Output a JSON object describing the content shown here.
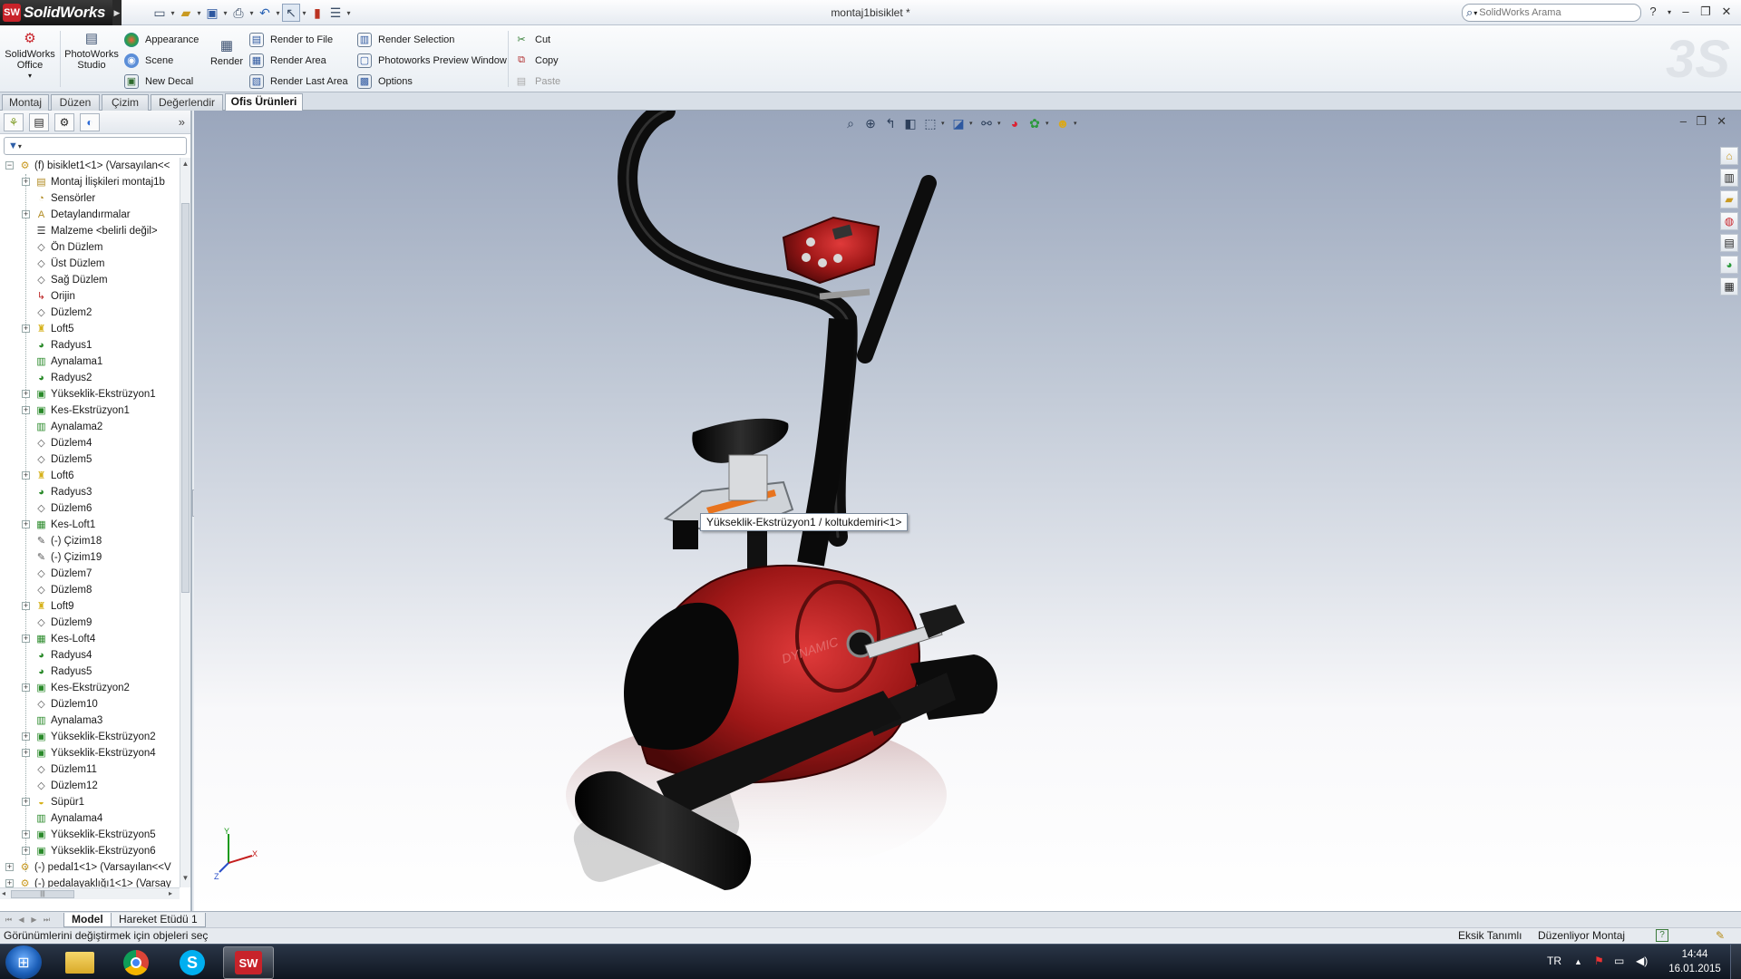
{
  "app": {
    "logo_text": "SolidWorks",
    "document_title": "montaj1bisiklet *",
    "search_placeholder": "SolidWorks Arama"
  },
  "command_manager": {
    "big_buttons": [
      {
        "label": "SolidWorks Office",
        "icon": "solidworks-office-icon"
      },
      {
        "label": "PhotoWorks Studio",
        "icon": "photoworks-studio-icon"
      },
      {
        "label": "Render",
        "icon": "render-icon"
      }
    ],
    "col1": [
      {
        "label": "Appearance",
        "icon": "appearance-icon"
      },
      {
        "label": "Scene",
        "icon": "scene-icon"
      },
      {
        "label": "New Decal",
        "icon": "decal-icon"
      }
    ],
    "col2": [
      {
        "label": "Render to File",
        "icon": "render-to-file-icon"
      },
      {
        "label": "Render Area",
        "icon": "render-area-icon"
      },
      {
        "label": "Render Last Area",
        "icon": "render-last-area-icon"
      }
    ],
    "col3": [
      {
        "label": "Render Selection",
        "icon": "render-selection-icon"
      },
      {
        "label": "Photoworks Preview Window",
        "icon": "preview-window-icon"
      },
      {
        "label": "Options",
        "icon": "options-icon"
      }
    ],
    "col4": [
      {
        "label": "Cut",
        "icon": "cut-icon"
      },
      {
        "label": "Copy",
        "icon": "copy-icon"
      },
      {
        "label": "Paste",
        "icon": "paste-icon",
        "disabled": true
      }
    ]
  },
  "tabs": [
    "Montaj",
    "Düzen",
    "Çizim",
    "Değerlendir",
    "Ofis Ürünleri"
  ],
  "active_tab": "Ofis Ürünleri",
  "feature_tree": [
    {
      "label": "(f) bisiklet1<1> (Varsayılan<<",
      "icon": "part-icon",
      "level": 0,
      "expander": "-"
    },
    {
      "label": "Montaj İlişkileri montaj1b",
      "icon": "mates-folder-icon",
      "level": 1,
      "expander": "+"
    },
    {
      "label": "Sensörler",
      "icon": "sensors-icon",
      "level": 1,
      "expander": ""
    },
    {
      "label": "Detaylandırmalar",
      "icon": "annotations-icon",
      "level": 1,
      "expander": "+"
    },
    {
      "label": "Malzeme <belirli değil>",
      "icon": "material-icon",
      "level": 1,
      "expander": ""
    },
    {
      "label": "Ön Düzlem",
      "icon": "plane-icon",
      "level": 1,
      "expander": ""
    },
    {
      "label": "Üst Düzlem",
      "icon": "plane-icon",
      "level": 1,
      "expander": ""
    },
    {
      "label": "Sağ Düzlem",
      "icon": "plane-icon",
      "level": 1,
      "expander": ""
    },
    {
      "label": "Orijin",
      "icon": "origin-icon",
      "level": 1,
      "expander": ""
    },
    {
      "label": "Düzlem2",
      "icon": "plane-icon",
      "level": 1,
      "expander": ""
    },
    {
      "label": "Loft5",
      "icon": "loft-icon",
      "level": 1,
      "expander": "+"
    },
    {
      "label": "Radyus1",
      "icon": "fillet-icon",
      "level": 1,
      "expander": ""
    },
    {
      "label": "Aynalama1",
      "icon": "mirror-icon",
      "level": 1,
      "expander": ""
    },
    {
      "label": "Radyus2",
      "icon": "fillet-icon",
      "level": 1,
      "expander": ""
    },
    {
      "label": "Yükseklik-Ekstrüzyon1",
      "icon": "extrude-icon",
      "level": 1,
      "expander": "+"
    },
    {
      "label": "Kes-Ekstrüzyon1",
      "icon": "cut-extrude-icon",
      "level": 1,
      "expander": "+"
    },
    {
      "label": "Aynalama2",
      "icon": "mirror-icon",
      "level": 1,
      "expander": ""
    },
    {
      "label": "Düzlem4",
      "icon": "plane-icon",
      "level": 1,
      "expander": ""
    },
    {
      "label": "Düzlem5",
      "icon": "plane-icon",
      "level": 1,
      "expander": ""
    },
    {
      "label": "Loft6",
      "icon": "loft-icon",
      "level": 1,
      "expander": "+"
    },
    {
      "label": "Radyus3",
      "icon": "fillet-icon",
      "level": 1,
      "expander": ""
    },
    {
      "label": "Düzlem6",
      "icon": "plane-icon",
      "level": 1,
      "expander": ""
    },
    {
      "label": "Kes-Loft1",
      "icon": "cut-loft-icon",
      "level": 1,
      "expander": "+"
    },
    {
      "label": "(-) Çizim18",
      "icon": "sketch-icon",
      "level": 1,
      "expander": ""
    },
    {
      "label": "(-) Çizim19",
      "icon": "sketch-icon",
      "level": 1,
      "expander": ""
    },
    {
      "label": "Düzlem7",
      "icon": "plane-icon",
      "level": 1,
      "expander": ""
    },
    {
      "label": "Düzlem8",
      "icon": "plane-icon",
      "level": 1,
      "expander": ""
    },
    {
      "label": "Loft9",
      "icon": "loft-icon",
      "level": 1,
      "expander": "+"
    },
    {
      "label": "Düzlem9",
      "icon": "plane-icon",
      "level": 1,
      "expander": ""
    },
    {
      "label": "Kes-Loft4",
      "icon": "cut-loft-icon",
      "level": 1,
      "expander": "+"
    },
    {
      "label": "Radyus4",
      "icon": "fillet-icon",
      "level": 1,
      "expander": ""
    },
    {
      "label": "Radyus5",
      "icon": "fillet-icon",
      "level": 1,
      "expander": ""
    },
    {
      "label": "Kes-Ekstrüzyon2",
      "icon": "cut-extrude-icon",
      "level": 1,
      "expander": "+"
    },
    {
      "label": "Düzlem10",
      "icon": "plane-icon",
      "level": 1,
      "expander": ""
    },
    {
      "label": "Aynalama3",
      "icon": "mirror-icon",
      "level": 1,
      "expander": ""
    },
    {
      "label": "Yükseklik-Ekstrüzyon2",
      "icon": "extrude-icon",
      "level": 1,
      "expander": "+"
    },
    {
      "label": "Yükseklik-Ekstrüzyon4",
      "icon": "extrude-icon",
      "level": 1,
      "expander": "+"
    },
    {
      "label": "Düzlem11",
      "icon": "plane-icon",
      "level": 1,
      "expander": ""
    },
    {
      "label": "Düzlem12",
      "icon": "plane-icon",
      "level": 1,
      "expander": ""
    },
    {
      "label": "Süpür1",
      "icon": "sweep-icon",
      "level": 1,
      "expander": "+"
    },
    {
      "label": "Aynalama4",
      "icon": "mirror-icon",
      "level": 1,
      "expander": ""
    },
    {
      "label": "Yükseklik-Ekstrüzyon5",
      "icon": "extrude-icon",
      "level": 1,
      "expander": "+"
    },
    {
      "label": "Yükseklik-Ekstrüzyon6",
      "icon": "extrude-icon",
      "level": 1,
      "expander": "+"
    },
    {
      "label": "(-) pedal1<1> (Varsayılan<<V",
      "icon": "part-icon",
      "level": 0,
      "expander": "+"
    },
    {
      "label": "(-) pedalayaklığı1<1> (Varsay",
      "icon": "part-icon",
      "level": 0,
      "expander": "+"
    }
  ],
  "viewport": {
    "tooltip": "Yükseklik-Ekstrüzyon1 / koltukdemiri<1>",
    "bike_brand": "DYNAMIC",
    "triad_labels": {
      "y": "Y",
      "x": "X",
      "z": "Z"
    }
  },
  "bottom_tabs": [
    "Model",
    "Hareket Etüdü 1"
  ],
  "status": {
    "message": "Görünümlerini değiştirmek için objeleri seç",
    "definition": "Eksik Tanımlı",
    "mode": "Düzenliyor Montaj"
  },
  "taskbar": {
    "language": "TR",
    "time": "14:44",
    "date": "16.01.2015",
    "apps": [
      "windows-explorer-icon",
      "chrome-icon",
      "skype-icon",
      "solidworks-icon"
    ]
  },
  "colors": {
    "accent_red": "#c8232a",
    "frame_black": "#121212",
    "viewport_top": "#9aa6bc"
  }
}
